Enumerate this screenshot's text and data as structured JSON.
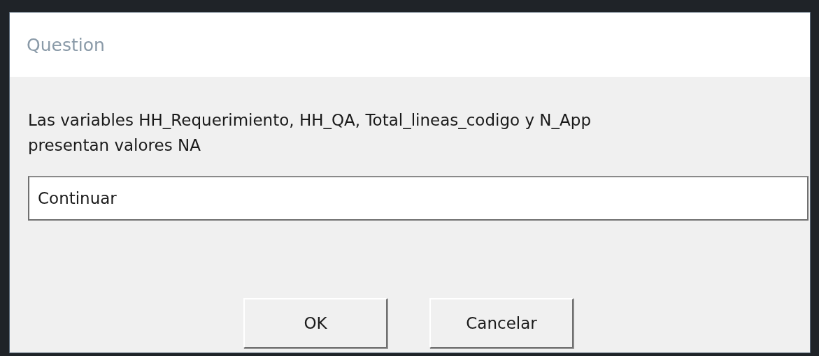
{
  "window": {
    "title": "Question"
  },
  "message": "Las variables HH_Requerimiento, HH_QA, Total_lineas_codigo y N_App presentan valores NA",
  "input": {
    "value": "Continuar"
  },
  "buttons": [
    "OK",
    "Cancelar"
  ]
}
